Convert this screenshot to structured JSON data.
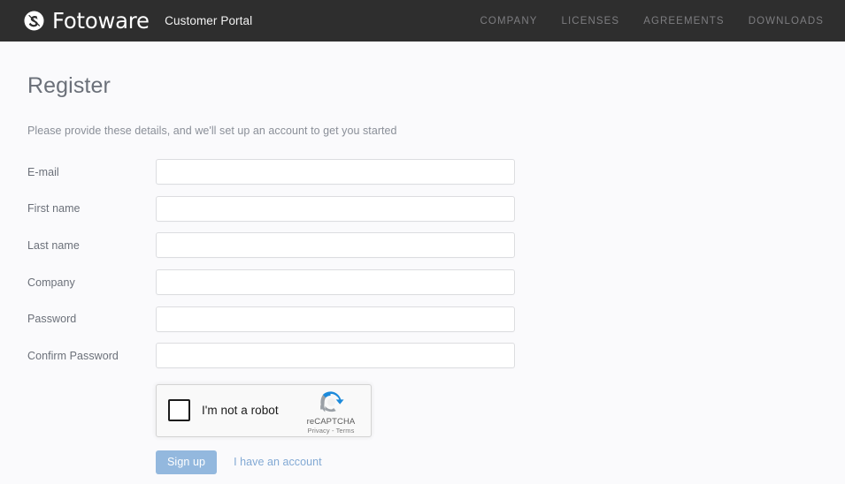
{
  "header": {
    "logo_icon": "fotoware-swirl-logo-icon",
    "brand_name": "Fotoware",
    "portal_label": "Customer Portal",
    "nav_items": [
      {
        "label": "COMPANY"
      },
      {
        "label": "LICENSES"
      },
      {
        "label": "AGREEMENTS"
      },
      {
        "label": "DOWNLOADS"
      }
    ],
    "background_color": "#2e2e2e",
    "nav_text_color": "#7d7d80"
  },
  "main": {
    "title": "Register",
    "subtitle": "Please provide these details, and we'll set up an account to get you started",
    "background_color": "#fafafc",
    "fields": [
      {
        "label": "E-mail",
        "value": "",
        "placeholder": ""
      },
      {
        "label": "First name",
        "value": "",
        "placeholder": ""
      },
      {
        "label": "Last name",
        "value": "",
        "placeholder": ""
      },
      {
        "label": "Company",
        "value": "",
        "placeholder": ""
      },
      {
        "label": "Password",
        "value": "",
        "placeholder": ""
      },
      {
        "label": "Confirm Password",
        "value": "",
        "placeholder": ""
      }
    ],
    "recaptcha": {
      "checkbox_label": "I'm not a robot",
      "brand_name": "reCAPTCHA",
      "legal_text": "Privacy - Terms",
      "logo_icon": "recaptcha-logo-icon",
      "checked": false
    },
    "actions": {
      "submit_label": "Sign up",
      "submit_color": "#93b8de",
      "alt_link_label": "I have an account",
      "alt_link_color": "#82a9d4"
    }
  }
}
